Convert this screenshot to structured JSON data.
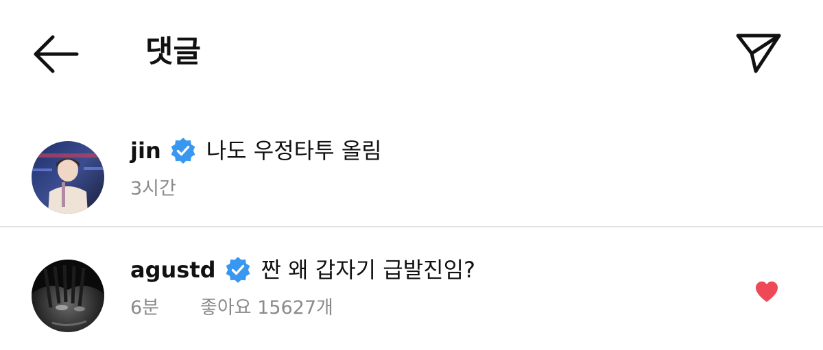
{
  "header": {
    "title": "댓글",
    "back_icon": "arrow-left-icon",
    "share_icon": "paper-plane-icon"
  },
  "comments": [
    {
      "username": "jin",
      "verified": true,
      "text": "나도 우정타투 올림",
      "time": "3시간",
      "liked": false
    },
    {
      "username": "agustd",
      "verified": true,
      "text": "짠 왜 갑자기 급발진임?",
      "time": "6분",
      "likes_label": "좋아요 15627개",
      "liked": true
    }
  ],
  "colors": {
    "verified": "#3897f0",
    "like": "#ed4956",
    "meta_text": "#8a8a8a",
    "divider": "#e3e3e3"
  }
}
